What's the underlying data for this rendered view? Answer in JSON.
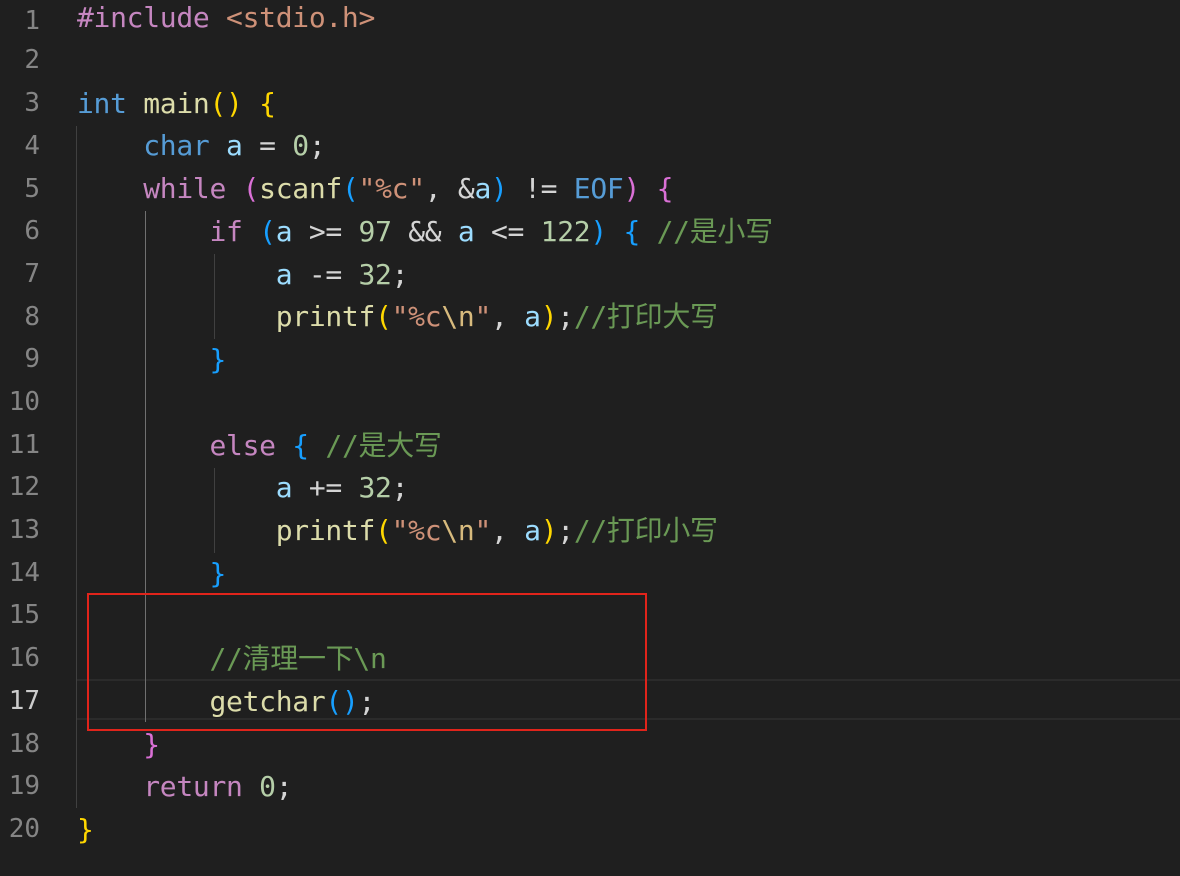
{
  "editor": {
    "line_numbers": [
      "1",
      "2",
      "3",
      "4",
      "5",
      "6",
      "7",
      "8",
      "9",
      "10",
      "11",
      "12",
      "13",
      "14",
      "15",
      "16",
      "17",
      "18",
      "19",
      "20"
    ],
    "active_line": "17",
    "lines": {
      "l1": {
        "pp": "#include",
        "sp": " ",
        "inc": "<stdio.h>"
      },
      "l3": {
        "kw": "int",
        "sp": " ",
        "fn": "main",
        "p_open": "(",
        "p_close": ")",
        "sp2": " ",
        "brace": "{"
      },
      "l4": {
        "indent": "    ",
        "kw": "char",
        "sp": " ",
        "var": "a",
        "op": " = ",
        "num": "0",
        "semi": ";"
      },
      "l5": {
        "indent": "    ",
        "kw": "while",
        "sp": " ",
        "p_open": "(",
        "fn": "scanf",
        "p2_open": "(",
        "str": "\"%c\"",
        "comma": ", ",
        "amp": "&",
        "var": "a",
        "p2_close": ")",
        "op": " != ",
        "eof": "EOF",
        "p_close": ")",
        "sp2": " ",
        "brace": "{"
      },
      "l6": {
        "indent": "        ",
        "kw": "if",
        "sp": " ",
        "p_open": "(",
        "var1": "a",
        "op1": " >= ",
        "num1": "97",
        "op2": " && ",
        "var2": "a",
        "op3": " <= ",
        "num2": "122",
        "p_close": ")",
        "sp2": " ",
        "brace": "{",
        "sp3": " ",
        "cmt": "//是小写"
      },
      "l7": {
        "indent": "            ",
        "var": "a",
        "op": " -= ",
        "num": "32",
        "semi": ";"
      },
      "l8": {
        "indent": "            ",
        "fn": "printf",
        "p_open": "(",
        "str1": "\"%c",
        "esc": "\\n",
        "str2": "\"",
        "comma": ", ",
        "var": "a",
        "p_close": ")",
        "semi": ";",
        "cmt": "//打印大写"
      },
      "l9": {
        "indent": "        ",
        "brace": "}"
      },
      "l11": {
        "indent": "        ",
        "kw": "else",
        "sp": " ",
        "brace": "{",
        "sp2": " ",
        "cmt": "//是大写"
      },
      "l12": {
        "indent": "            ",
        "var": "a",
        "op": " += ",
        "num": "32",
        "semi": ";"
      },
      "l13": {
        "indent": "            ",
        "fn": "printf",
        "p_open": "(",
        "str1": "\"%c",
        "esc": "\\n",
        "str2": "\"",
        "comma": ", ",
        "var": "a",
        "p_close": ")",
        "semi": ";",
        "cmt": "//打印小写"
      },
      "l14": {
        "indent": "        ",
        "brace": "}"
      },
      "l16": {
        "indent": "        ",
        "cmt": "//清理一下\\n"
      },
      "l17": {
        "indent": "        ",
        "fn": "getchar",
        "p_open": "(",
        "p_close": ")",
        "semi": ";"
      },
      "l18": {
        "indent": "    ",
        "brace": "}"
      },
      "l19": {
        "indent": "    ",
        "kw": "return",
        "sp": " ",
        "num": "0",
        "semi": ";"
      },
      "l20": {
        "brace": "}"
      }
    }
  },
  "colors": {
    "background": "#1f1f1f",
    "annotation_box": "#e0241b",
    "keyword": "#569cd6",
    "control_keyword": "#c586c0",
    "function": "#dcdcaa",
    "variable": "#9cdcfe",
    "number": "#b5cea8",
    "string": "#ce9178",
    "comment": "#6a9955"
  }
}
